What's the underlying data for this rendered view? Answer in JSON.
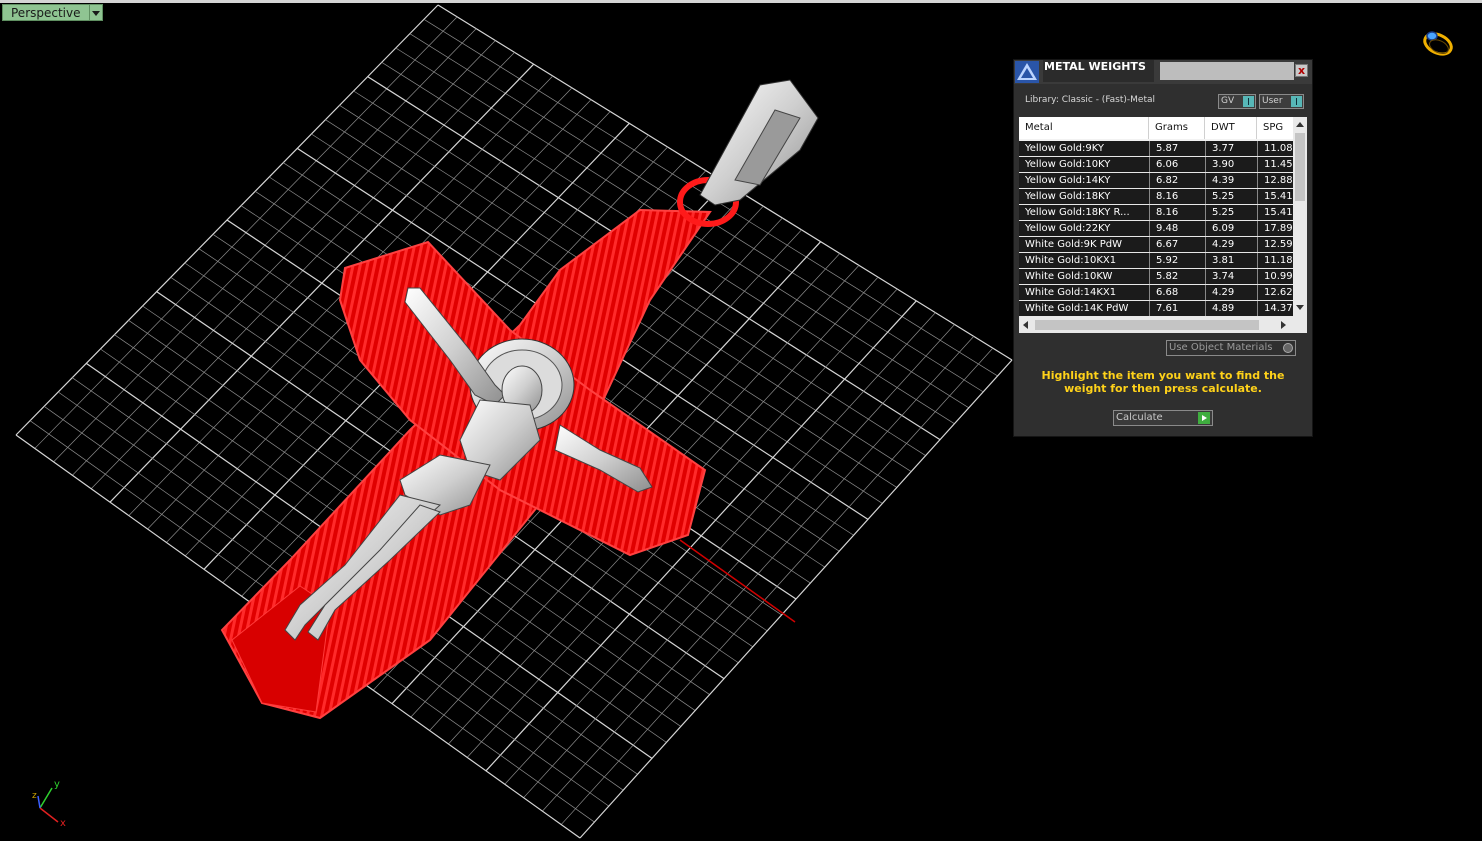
{
  "viewport": {
    "label": "Perspective",
    "axis": {
      "x": "x",
      "y": "y",
      "z": "z"
    }
  },
  "panel": {
    "title": "METAL WEIGHTS",
    "close_label": "x",
    "library_label": "Library: Classic - (Fast)-Metal",
    "gv_label": "GV",
    "user_label": "User",
    "columns": [
      "Metal",
      "Grams",
      "DWT",
      "SPG"
    ],
    "rows": [
      {
        "metal": "Yellow Gold:9KY",
        "grams": "5.87",
        "dwt": "3.77",
        "spg": "11.08"
      },
      {
        "metal": "Yellow Gold:10KY",
        "grams": "6.06",
        "dwt": "3.90",
        "spg": "11.45"
      },
      {
        "metal": "Yellow Gold:14KY",
        "grams": "6.82",
        "dwt": "4.39",
        "spg": "12.88"
      },
      {
        "metal": "Yellow Gold:18KY",
        "grams": "8.16",
        "dwt": "5.25",
        "spg": "15.41"
      },
      {
        "metal": "Yellow Gold:18KY R...",
        "grams": "8.16",
        "dwt": "5.25",
        "spg": "15.41"
      },
      {
        "metal": "Yellow Gold:22KY",
        "grams": "9.48",
        "dwt": "6.09",
        "spg": "17.89"
      },
      {
        "metal": "White Gold:9K PdW",
        "grams": "6.67",
        "dwt": "4.29",
        "spg": "12.59"
      },
      {
        "metal": "White Gold:10KX1",
        "grams": "5.92",
        "dwt": "3.81",
        "spg": "11.18"
      },
      {
        "metal": "White Gold:10KW",
        "grams": "5.82",
        "dwt": "3.74",
        "spg": "10.99"
      },
      {
        "metal": "White Gold:14KX1",
        "grams": "6.68",
        "dwt": "4.29",
        "spg": "12.62"
      },
      {
        "metal": "White Gold:14K PdW",
        "grams": "7.61",
        "dwt": "4.89",
        "spg": "14.37"
      }
    ],
    "use_materials_label": "Use Object Materials",
    "instruction": "Highlight the item you want to find the weight for then press calculate.",
    "calculate_label": "Calculate"
  },
  "colors": {
    "viewport_bg": "#000000",
    "grid": "#bdbdbd",
    "model_red": "#ff1010",
    "model_silver": "#e2e2e2",
    "label_green": "#8fc492",
    "instruction_yellow": "#ffd21a",
    "calc_green": "#3fae3f"
  }
}
